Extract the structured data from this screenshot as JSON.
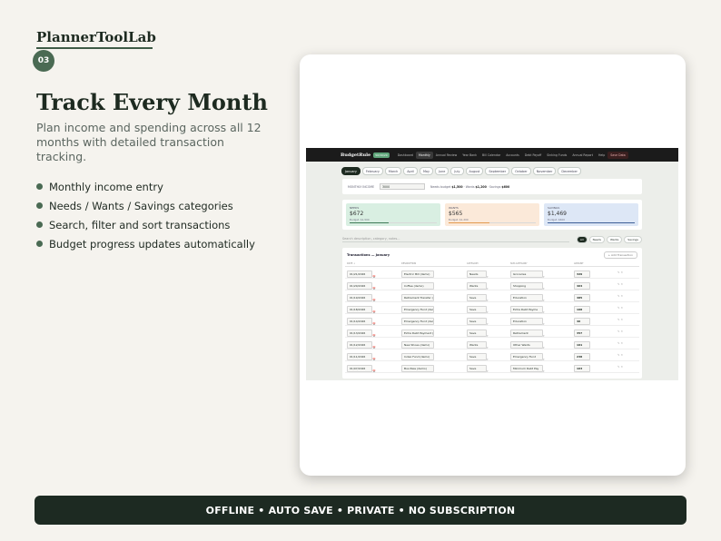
{
  "brand": {
    "name": "PlannerToolLab",
    "step": "03"
  },
  "hero": {
    "headline": "Track Every Month",
    "subtitle": "Plan income and spending across all 12 months with detailed transaction tracking.",
    "features": [
      "Monthly income entry",
      "Needs / Wants / Savings categories",
      "Search, filter and sort transactions",
      "Budget progress updates automatically"
    ]
  },
  "app": {
    "logo": "BudgetRule",
    "logo_pill": "50/30/20",
    "nav": [
      "Dashboard",
      "Monthly",
      "Annual Review",
      "Year Bank",
      "Bill Calendar",
      "Accounts",
      "Debt Payoff",
      "Sinking Funds",
      "Annual Report",
      "Help",
      "Save Data"
    ],
    "months": [
      "January",
      "February",
      "March",
      "April",
      "May",
      "June",
      "July",
      "August",
      "September",
      "October",
      "November",
      "December"
    ],
    "income": {
      "label": "MONTHLY INCOME",
      "value": "3000",
      "summary_prefix": "Needs budget",
      "needs": "$1,500",
      "wants_label": "Wants",
      "wants": "$1,200",
      "savings_label": "Savings",
      "savings": "$600"
    },
    "categories": [
      {
        "name": "NEEDS",
        "value": "$672",
        "budget": "Budget: $1,500",
        "fill": 0.45,
        "bg": "#d9efe2",
        "bar": "#3f7a57"
      },
      {
        "name": "WANTS",
        "value": "$565",
        "budget": "Budget: $1,200",
        "fill": 0.47,
        "bg": "#fbe9d9",
        "bar": "#e39a4e"
      },
      {
        "name": "SAVINGS",
        "value": "$1,469",
        "budget": "Budget: $600",
        "fill": 1.0,
        "bg": "#dde7f6",
        "bar": "#3e5f97"
      }
    ],
    "search": {
      "placeholder": "Search description, category, notes...",
      "filters": [
        "All",
        "Needs",
        "Wants",
        "Savings"
      ]
    },
    "transactions": {
      "title": "Transactions — January",
      "add_label": "+ Add Transaction",
      "columns": [
        "DATE ↓",
        "DESCRIPTION",
        "CATEGORY",
        "SUB-CATEGORY",
        "AMOUNT",
        ""
      ],
      "rows": [
        {
          "date": "01/21/2026",
          "desc": "Electric Bill (demo)",
          "cat": "Needs",
          "sub": "Groceries",
          "amount": "329"
        },
        {
          "date": "01/20/2026",
          "desc": "Coffee (demo)",
          "cat": "Wants",
          "sub": "Shopping",
          "amount": "464"
        },
        {
          "date": "01/19/2026",
          "desc": "Retirement Transfer (de",
          "cat": "Save",
          "sub": "Education",
          "amount": "485"
        },
        {
          "date": "01/18/2026",
          "desc": "Emergency Fund (demo)",
          "cat": "Save",
          "sub": "Extra Debt Payme",
          "amount": "108"
        },
        {
          "date": "01/14/2026",
          "desc": "Emergency Fund (demo)",
          "cat": "Save",
          "sub": "Education",
          "amount": "46"
        },
        {
          "date": "01/13/2026",
          "desc": "Extra Debt Payment (de",
          "cat": "Save",
          "sub": "Retirement",
          "amount": "357"
        },
        {
          "date": "01/12/2026",
          "desc": "New Shoes (demo)",
          "cat": "Wants",
          "sub": "Other Wants",
          "amount": "101"
        },
        {
          "date": "01/11/2026",
          "desc": "Index Fund (demo)",
          "cat": "Save",
          "sub": "Emergency Fund",
          "amount": "238"
        },
        {
          "date": "01/07/2026",
          "desc": "Bus Pass (demo)",
          "cat": "Save",
          "sub": "Minimum Debt Pay",
          "amount": "163"
        }
      ]
    }
  },
  "footer": "OFFLINE  •  AUTO SAVE  •  PRIVATE  •  NO SUBSCRIPTION"
}
